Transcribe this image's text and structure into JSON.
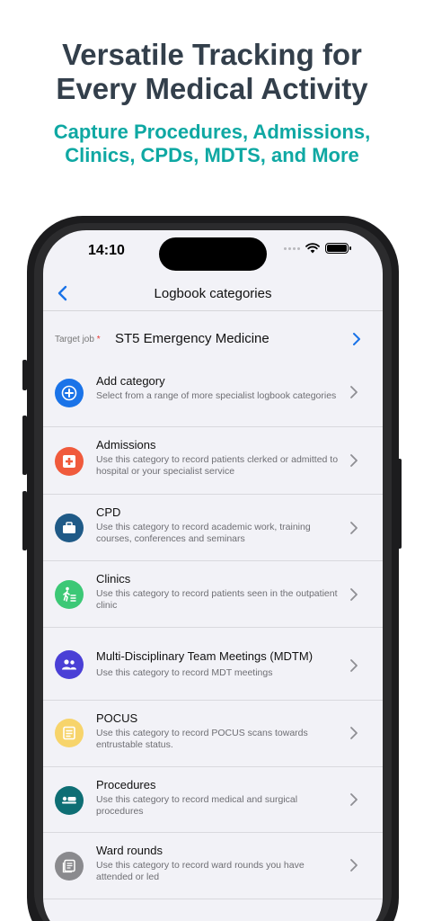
{
  "promo": {
    "headline_line1": "Versatile Tracking for",
    "headline_line2": "Every Medical Activity",
    "subline_line1": "Capture Procedures, Admissions,",
    "subline_line2": "Clinics, CPDs, MDTS, and More"
  },
  "status_bar": {
    "time": "14:10"
  },
  "nav": {
    "title": "Logbook categories",
    "back_icon": "chevron-left-icon"
  },
  "target_job": {
    "label": "Target job",
    "required_mark": "*",
    "value": "ST5 Emergency Medicine"
  },
  "colors": {
    "accent": "#1a73e8",
    "headline": "#333f4b",
    "subline": "#0fa8a3"
  },
  "items": [
    {
      "title": "Add category",
      "desc": "Select from a range of more specialist logbook categories",
      "icon": "plus-circle-icon",
      "color": "#1a73e8"
    },
    {
      "title": "Admissions",
      "desc": "Use this category to record patients clerked or admitted to hospital or your specialist service",
      "icon": "medical-cross-icon",
      "color": "#f05a3c"
    },
    {
      "title": "CPD",
      "desc": "Use this category to record academic work, training courses, conferences and seminars",
      "icon": "briefcase-icon",
      "color": "#1f5a87"
    },
    {
      "title": "Clinics",
      "desc": "Use this category to record patients seen in the outpatient clinic",
      "icon": "walking-person-icon",
      "color": "#3cc876"
    },
    {
      "title": "Multi-Disciplinary Team Meetings (MDTM)",
      "desc": "Use this category to record MDT meetings",
      "icon": "people-icon",
      "color": "#4a3fd6"
    },
    {
      "title": "POCUS",
      "desc": "Use this category to record POCUS scans towards entrustable status.",
      "icon": "document-icon",
      "color": "#f7d46b"
    },
    {
      "title": "Procedures",
      "desc": "Use this category to record medical and surgical procedures",
      "icon": "bed-icon",
      "color": "#0e6e74"
    },
    {
      "title": "Ward rounds",
      "desc": "Use this category to record ward rounds you have attended or led",
      "icon": "notes-icon",
      "color": "#8a8a8e"
    }
  ]
}
